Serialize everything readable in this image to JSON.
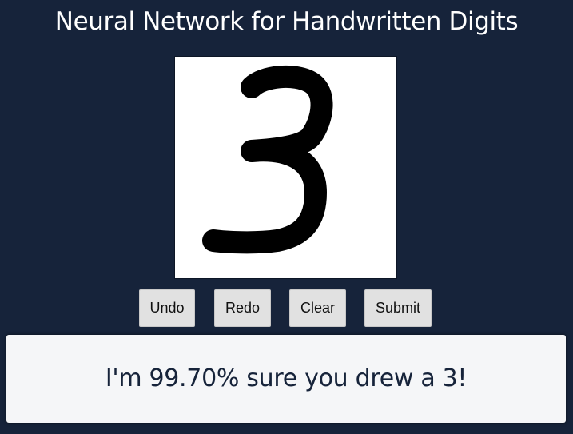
{
  "header": {
    "title": "Neural Network for Handwritten Digits"
  },
  "canvas": {
    "drawn_digit_icon": "handwritten-3-stroke",
    "stroke_color": "#000000",
    "background_color": "#ffffff"
  },
  "toolbar": {
    "undo_label": "Undo",
    "redo_label": "Redo",
    "clear_label": "Clear",
    "submit_label": "Submit"
  },
  "result": {
    "message": "I'm 99.70% sure you drew a 3!"
  },
  "colors": {
    "page_background": "#16233a",
    "panel_background": "#f5f6f8",
    "button_background": "#e1e1e1"
  }
}
